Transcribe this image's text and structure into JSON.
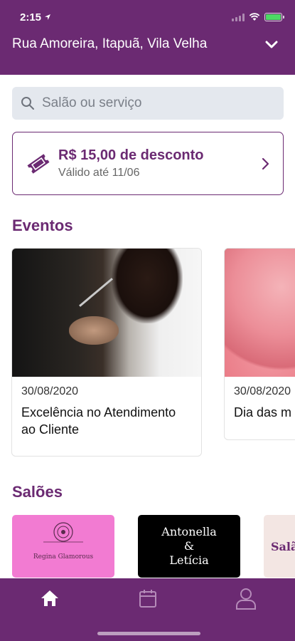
{
  "status_bar": {
    "time": "2:15"
  },
  "header": {
    "address": "Rua Amoreira, Itapuã, Vila Velha"
  },
  "search": {
    "placeholder": "Salão ou serviço"
  },
  "coupon": {
    "title": "R$ 15,00 de desconto",
    "subtitle": "Válido até 11/06"
  },
  "sections": {
    "events_title": "Eventos",
    "salons_title": "Salões"
  },
  "events": [
    {
      "date": "30/08/2020",
      "title": "Excelência no Atendimento ao Cliente",
      "image": "haircut-photo"
    },
    {
      "date": "30/08/2020",
      "title": "Dia das m",
      "image": "pink-flowers-photo"
    }
  ],
  "salons": [
    {
      "name": "Regina Glamorous",
      "background": "#f27bd2"
    },
    {
      "name_line1": "Antonella",
      "name_line2": "&",
      "name_line3": "Letícia",
      "background": "#000000"
    },
    {
      "name": "Salã",
      "background": "#f3e6e3"
    }
  ],
  "tabs": [
    {
      "icon": "home-icon",
      "active": true
    },
    {
      "icon": "calendar-icon",
      "active": false
    },
    {
      "icon": "profile-icon",
      "active": false
    }
  ],
  "colors": {
    "brand": "#6b2a72",
    "search_bg": "#e4e8ee",
    "battery": "#4cd964"
  }
}
